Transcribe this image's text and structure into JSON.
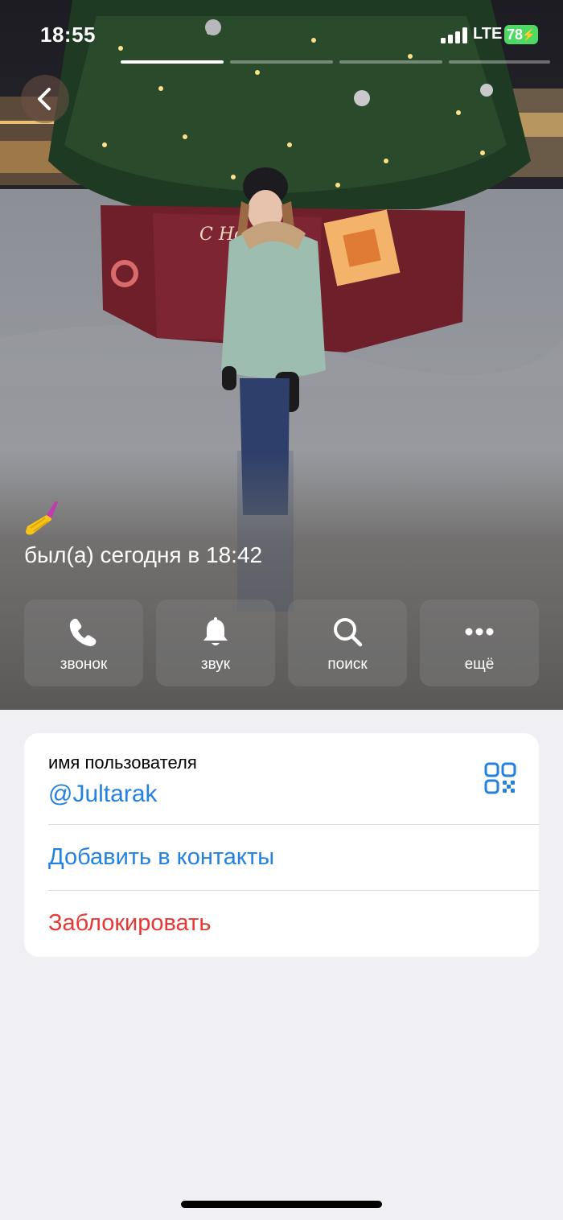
{
  "status_bar": {
    "time": "18:55",
    "network": "LTE",
    "battery": "78"
  },
  "story": {
    "segments": 4,
    "active_index": 0
  },
  "profile": {
    "last_seen": "был(а) сегодня в 18:42",
    "emoji_status": "nail-polish"
  },
  "actions": [
    {
      "label": "звонок",
      "icon": "phone-icon"
    },
    {
      "label": "звук",
      "icon": "bell-icon"
    },
    {
      "label": "поиск",
      "icon": "search-icon"
    },
    {
      "label": "ещё",
      "icon": "more-icon"
    }
  ],
  "info": {
    "username_label": "имя пользователя",
    "username": "@Jultarak",
    "add_contact": "Добавить в контакты",
    "block": "Заблокировать"
  },
  "colors": {
    "accent": "#2382e0",
    "danger": "#e53935",
    "battery": "#4cd964",
    "background": "#efeff4"
  }
}
